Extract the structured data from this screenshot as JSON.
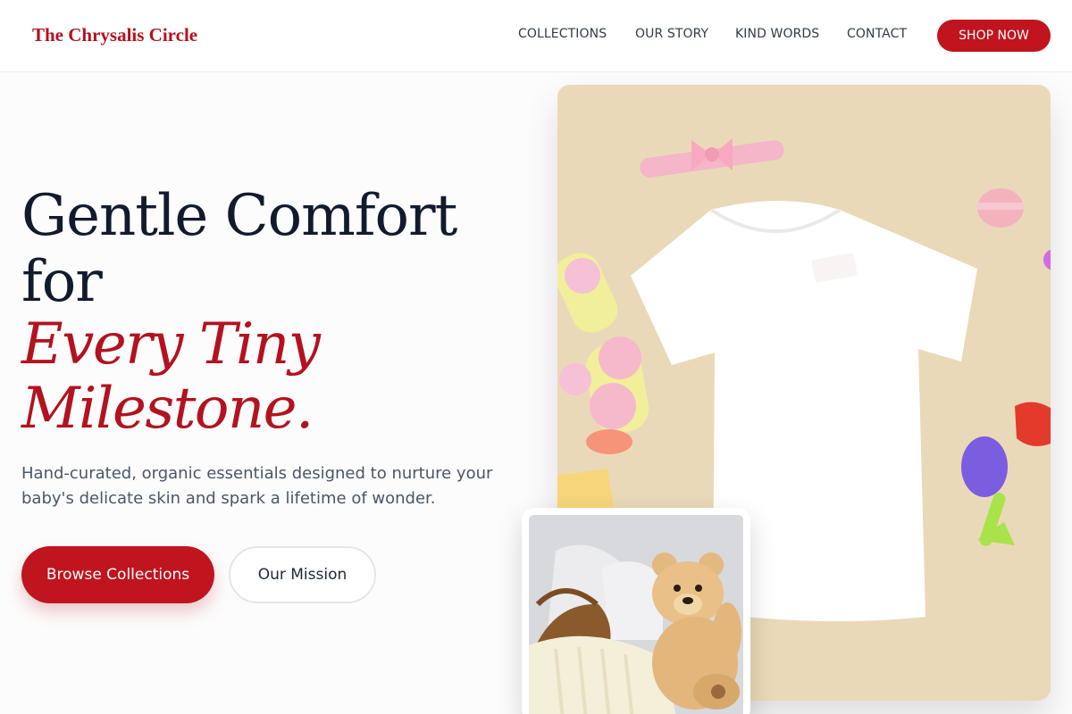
{
  "brand": {
    "name": "The Chrysalis Circle"
  },
  "nav": {
    "items": [
      {
        "label": "COLLECTIONS"
      },
      {
        "label": "OUR STORY"
      },
      {
        "label": "KIND WORDS"
      },
      {
        "label": "CONTACT"
      }
    ],
    "cta_label": "SHOP NOW"
  },
  "hero": {
    "headline_line1": "Gentle Comfort",
    "headline_line2": "for",
    "accent_line1": "Every Tiny",
    "accent_line2": "Milestone.",
    "subtitle": "Hand-curated, organic essentials designed to nurture your baby's delicate skin and spark a lifetime of wonder.",
    "primary_button": "Browse Collections",
    "secondary_button": "Our Mission"
  },
  "images": {
    "main_image": "baby-tshirt-flatlay-photo",
    "inset_image": "teddy-bear-blanket-basket-photo"
  },
  "colors": {
    "accent": "#c0141f",
    "headline": "#121a2e",
    "body_text": "#4b5566",
    "photo_background": "#ead9b8"
  }
}
